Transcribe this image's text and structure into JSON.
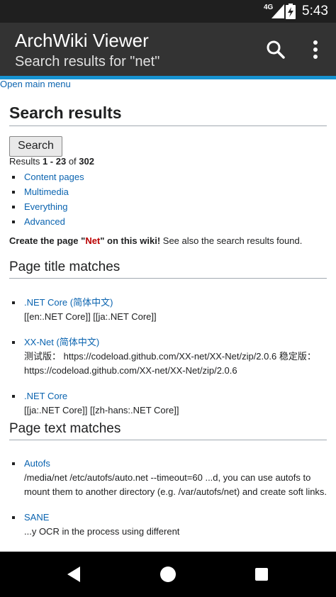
{
  "status_bar": {
    "network": "4G",
    "time": "5:43"
  },
  "app_bar": {
    "title": "ArchWiki Viewer",
    "subtitle": "Search results for \"net\""
  },
  "page": {
    "open_menu": "Open main menu",
    "heading": "Search results",
    "search_button": "Search",
    "results": {
      "prefix": "Results ",
      "range": "1 - 23",
      "mid": " of ",
      "total": "302"
    },
    "categories": [
      "Content pages",
      "Multimedia",
      "Everything",
      "Advanced"
    ],
    "create": {
      "prefix": "Create the page \"",
      "page_name": "Net",
      "suffix": "\" on this wiki!",
      "rest": " See also the search results found."
    },
    "title_matches_heading": "Page title matches",
    "title_matches": [
      {
        "title": ".NET Core (简体中文)",
        "snippet": "[[en:.NET Core]] [[ja:.NET Core]]"
      },
      {
        "title": "XX-Net (简体中文)",
        "snippet": "测试版： https://codeload.github.com/XX-net/XX-Net/zip/2.0.6 稳定版： https://codeload.github.com/XX-net/XX-Net/zip/2.0.6"
      },
      {
        "title": ".NET Core",
        "snippet": "[[ja:.NET Core]] [[zh-hans:.NET Core]]"
      }
    ],
    "text_matches_heading": "Page text matches",
    "text_matches": [
      {
        "title": "Autofs",
        "snippet": "/media/net /etc/autofs/auto.net --timeout=60 ...d, you can use autofs to mount them to another directory (e.g. /var/autofs/net) and create soft links."
      },
      {
        "title": "SANE",
        "snippet": "...y OCR in the process using different"
      }
    ]
  },
  "nav_bar": {
    "icons": [
      "back-icon",
      "home-icon",
      "recents-icon"
    ]
  },
  "colors": {
    "accent": "#1793d1",
    "link": "#0b64b0",
    "new_page": "#ba0000",
    "app_bar": "#333333"
  }
}
